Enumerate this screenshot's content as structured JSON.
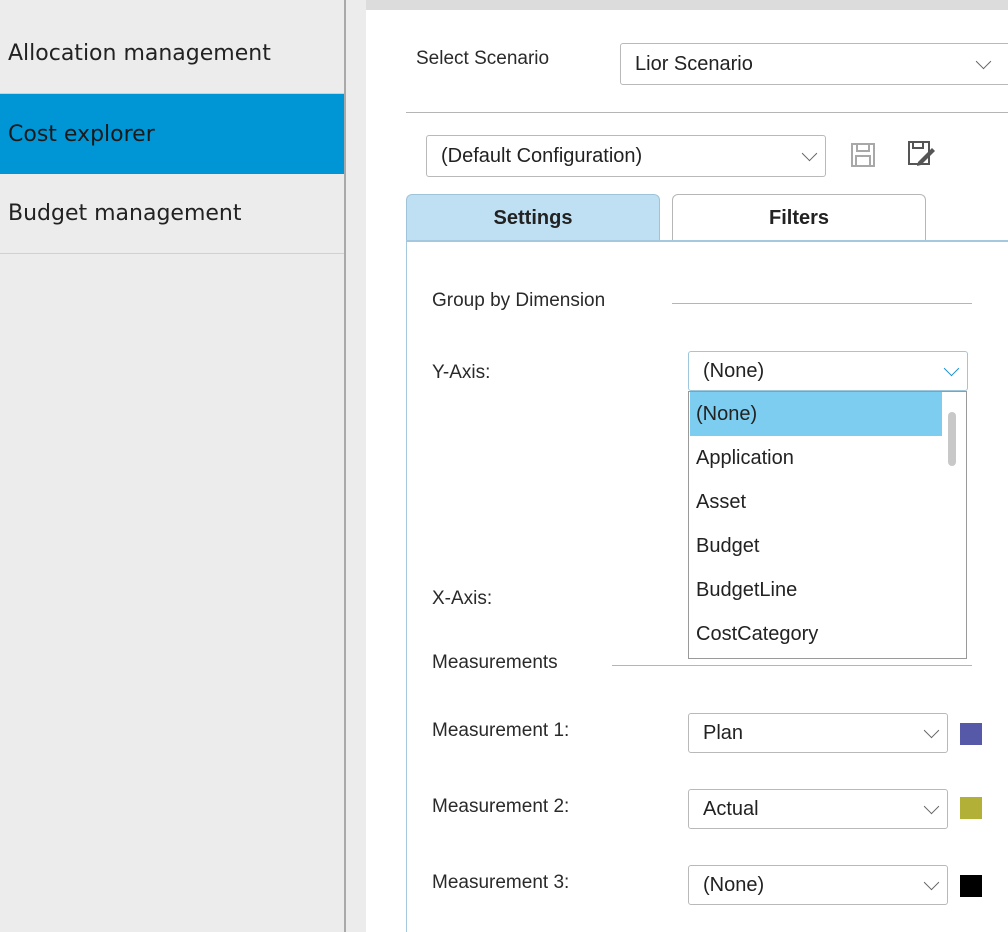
{
  "sidebar": {
    "items": [
      {
        "label": "Allocation management",
        "active": false
      },
      {
        "label": "Cost explorer",
        "active": true
      },
      {
        "label": "Budget management",
        "active": false
      }
    ]
  },
  "scenario": {
    "label": "Select Scenario",
    "value": "Lior Scenario"
  },
  "configuration": {
    "value": "(Default Configuration)",
    "save_icon": "save-icon",
    "edit_icon": "save-as-icon"
  },
  "tabs": [
    {
      "label": "Settings",
      "active": true
    },
    {
      "label": "Filters",
      "active": false
    }
  ],
  "group_by": {
    "section_title": "Group by Dimension",
    "y_axis_label": "Y-Axis:",
    "y_axis_value": "(None)",
    "x_axis_label": "X-Axis:",
    "y_axis_options": [
      "(None)",
      "Application",
      "Asset",
      "Budget",
      "BudgetLine",
      "CostCategory"
    ],
    "selected_index": 0
  },
  "measurements": {
    "section_title": "Measurements",
    "items": [
      {
        "label": "Measurement 1:",
        "value": "Plan",
        "color": "#5659a8"
      },
      {
        "label": "Measurement 2:",
        "value": "Actual",
        "color": "#b3b038"
      },
      {
        "label": "Measurement 3:",
        "value": "(None)",
        "color": "#000000"
      }
    ]
  }
}
